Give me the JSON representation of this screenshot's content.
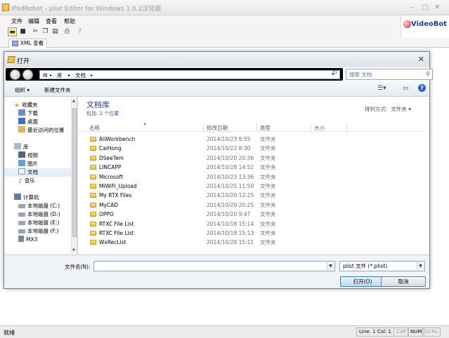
{
  "app": {
    "title": "iPodRobot - plist Editor for Windows 1.0.2汉化版",
    "menu": [
      "文件",
      "编辑",
      "查看",
      "帮助"
    ],
    "brand": "VideoBot",
    "tab": "XML 查看"
  },
  "toolbar": {
    "icons": [
      "open-folder-icon",
      "save-icon",
      "cut-icon",
      "copy-icon",
      "paste-icon",
      "print-icon",
      "help-pointer-icon"
    ]
  },
  "statusbar": {
    "ready": "就绪",
    "position": "Line: 1 Col: 1",
    "caps": "CAP",
    "num": "NUM",
    "scrl": "SCRL"
  },
  "dialog": {
    "title": "打开",
    "breadcrumb": [
      "库",
      "文档"
    ],
    "search_placeholder": "搜索 文档",
    "organize": "组织",
    "new_folder": "新建文件夹",
    "library_title": "文档库",
    "library_sub_prefix": "包括:",
    "library_sub_link": "2 个位置",
    "arrange_label": "排列方式:",
    "arrange_value": "文件夹",
    "columns": [
      "名称",
      "修改日期",
      "类型",
      "大小"
    ],
    "nav": {
      "favorites": "收藏夹",
      "downloads": "下载",
      "desktop": "桌面",
      "recent": "最近访问的位置",
      "libraries": "库",
      "videos": "视频",
      "pictures": "图片",
      "documents": "文档",
      "music": "音乐",
      "computer": "计算机",
      "drive_c": "本地磁盘 (C:)",
      "drive_d": "本地磁盘 (D:)",
      "drive_e": "本地磁盘 (E:)",
      "drive_f": "本地磁盘 (F:)",
      "mx3": "MX3"
    },
    "files": [
      {
        "name": "AliWorkbench",
        "date": "2014/10/23 9:55",
        "type": "文件夹"
      },
      {
        "name": "CaiHong",
        "date": "2014/10/22 8:30",
        "type": "文件夹"
      },
      {
        "name": "DSeeTem",
        "date": "2014/10/20 20:36",
        "type": "文件夹"
      },
      {
        "name": "LINCAPP",
        "date": "2014/10/28 14:52",
        "type": "文件夹"
      },
      {
        "name": "Microsoft",
        "date": "2014/10/23 13:36",
        "type": "文件夹"
      },
      {
        "name": "MiWiFi_Upload",
        "date": "2014/10/25 11:50",
        "type": "文件夹"
      },
      {
        "name": "My RTX Files",
        "date": "2014/10/20 12:25",
        "type": "文件夹"
      },
      {
        "name": "MyCAD",
        "date": "2014/10/20 20:25",
        "type": "文件夹"
      },
      {
        "name": "OPPO",
        "date": "2014/10/20 9:47",
        "type": "文件夹"
      },
      {
        "name": "RTXC File List",
        "date": "2014/10/18 15:14",
        "type": "文件夹"
      },
      {
        "name": "RTXC File List",
        "date": "2014/10/18 15:13",
        "type": "文件夹"
      },
      {
        "name": "WxRecList",
        "date": "2014/10/28 15:11",
        "type": "文件夹"
      }
    ],
    "filename_label": "文件名(N):",
    "filename_value": "",
    "filetype": "plist 文件 (*.plist)",
    "open_button": "打开(O)",
    "cancel_button": "取消"
  }
}
